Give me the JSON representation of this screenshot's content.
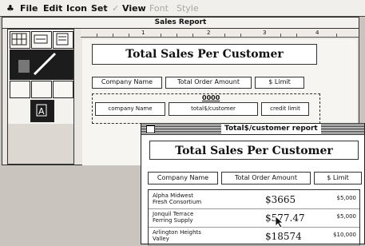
{
  "menu": {
    "apple": "♣",
    "items": [
      "File",
      "Edit",
      "Icon",
      "Set"
    ],
    "dim_mark": "✓",
    "view": "View",
    "disabled": [
      "Font",
      "Style"
    ]
  },
  "back_window": {
    "title": "Sales Report",
    "ruler_ticks": [
      "1",
      "2",
      "3",
      "4"
    ],
    "layout": {
      "title": "Total Sales Per Customer",
      "headers": [
        "Company Name",
        "Total Order Amount",
        "$ Limit"
      ],
      "formula_label": "0000",
      "fields": [
        "company Name",
        "total$/customer",
        "credit limit"
      ]
    }
  },
  "front_window": {
    "title": "Total$/customer report",
    "report_title": "Total Sales Per Customer",
    "headers": [
      "Company Name",
      "Total Order Amount",
      "$ Limit"
    ],
    "rows": [
      {
        "name": "Alpha Midwest",
        "name2": "Fresh Consortium",
        "total": "$3665",
        "limit": "$5,000"
      },
      {
        "name": "Jonquil Terrace",
        "name2": "Ferring Supply",
        "total": "$577.47",
        "limit": "$5,000"
      },
      {
        "name": "Arlington Heights",
        "name2": "Valley",
        "total": "$18574",
        "limit": "$10,000"
      }
    ]
  }
}
